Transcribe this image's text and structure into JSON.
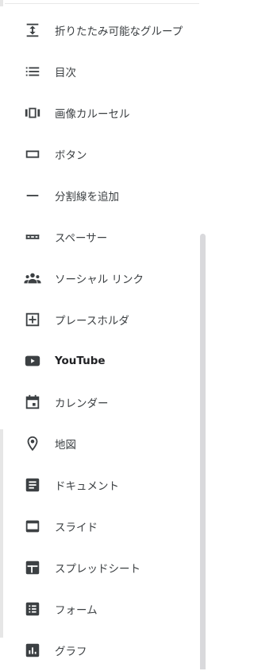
{
  "menu": {
    "items": [
      {
        "icon": "collapsible-group-icon",
        "label": "折りたたみ可能なグループ"
      },
      {
        "icon": "table-of-contents-icon",
        "label": "目次"
      },
      {
        "icon": "image-carousel-icon",
        "label": "画像カルーセル"
      },
      {
        "icon": "button-icon",
        "label": "ボタン"
      },
      {
        "icon": "divider-icon",
        "label": "分割線を追加"
      },
      {
        "icon": "spacer-icon",
        "label": "スペーサー"
      },
      {
        "icon": "social-links-icon",
        "label": "ソーシャル リンク"
      },
      {
        "icon": "placeholder-icon",
        "label": "プレースホルダ"
      },
      {
        "icon": "youtube-icon",
        "label": "YouTube"
      },
      {
        "icon": "calendar-icon",
        "label": "カレンダー"
      },
      {
        "icon": "map-pin-icon",
        "label": "地図"
      },
      {
        "icon": "docs-icon",
        "label": "ドキュメント"
      },
      {
        "icon": "slides-icon",
        "label": "スライド"
      },
      {
        "icon": "sheets-icon",
        "label": "スプレッドシート"
      },
      {
        "icon": "forms-icon",
        "label": "フォーム"
      },
      {
        "icon": "chart-icon",
        "label": "グラフ"
      }
    ]
  },
  "colors": {
    "icon": "#3c4043",
    "text": "#3c4043",
    "scrollbar": "#d9d9dc"
  }
}
